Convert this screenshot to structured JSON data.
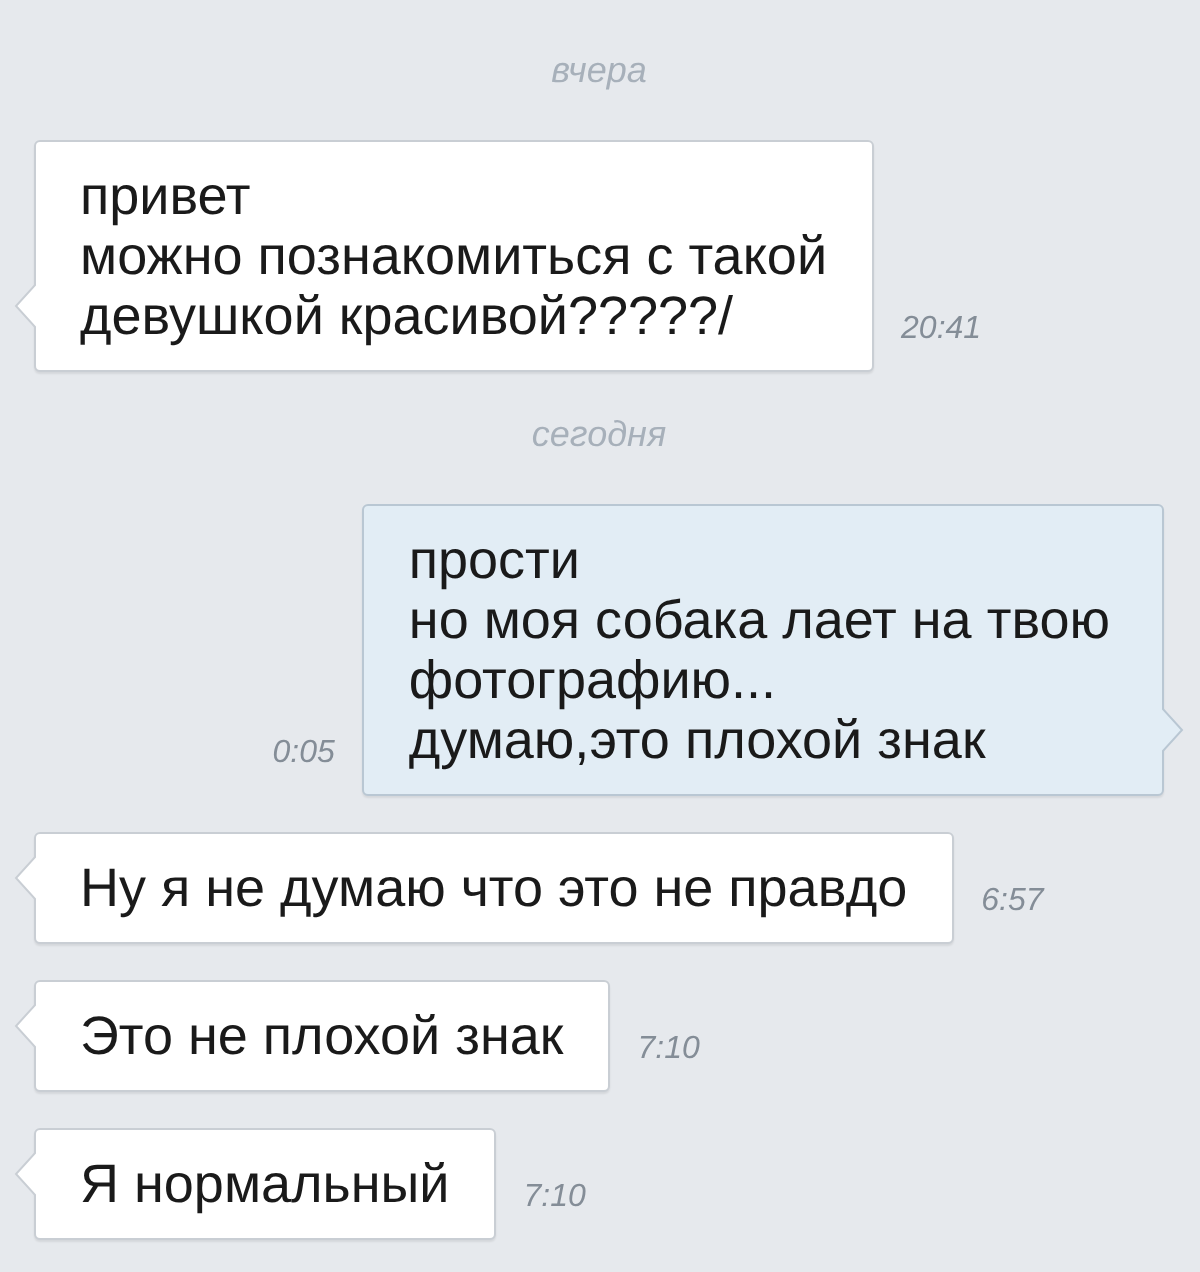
{
  "messages": [
    {
      "kind": "date",
      "text": "вчера"
    },
    {
      "kind": "incoming",
      "text": "привет\nможно познакомиться с такой\nдевушкой красивой?????/",
      "time": "20:41"
    },
    {
      "kind": "date",
      "text": "сегодня"
    },
    {
      "kind": "outgoing",
      "text": "прости\nно моя собака лает на твою\nфотографию...\nдумаю,это плохой знак",
      "time": "0:05"
    },
    {
      "kind": "incoming",
      "text": "Ну я не думаю что это не правдо",
      "time": "6:57"
    },
    {
      "kind": "incoming",
      "text": "Это не плохой знак",
      "time": "7:10"
    },
    {
      "kind": "incoming",
      "text": "Я нормальный",
      "time": "7:10"
    }
  ]
}
